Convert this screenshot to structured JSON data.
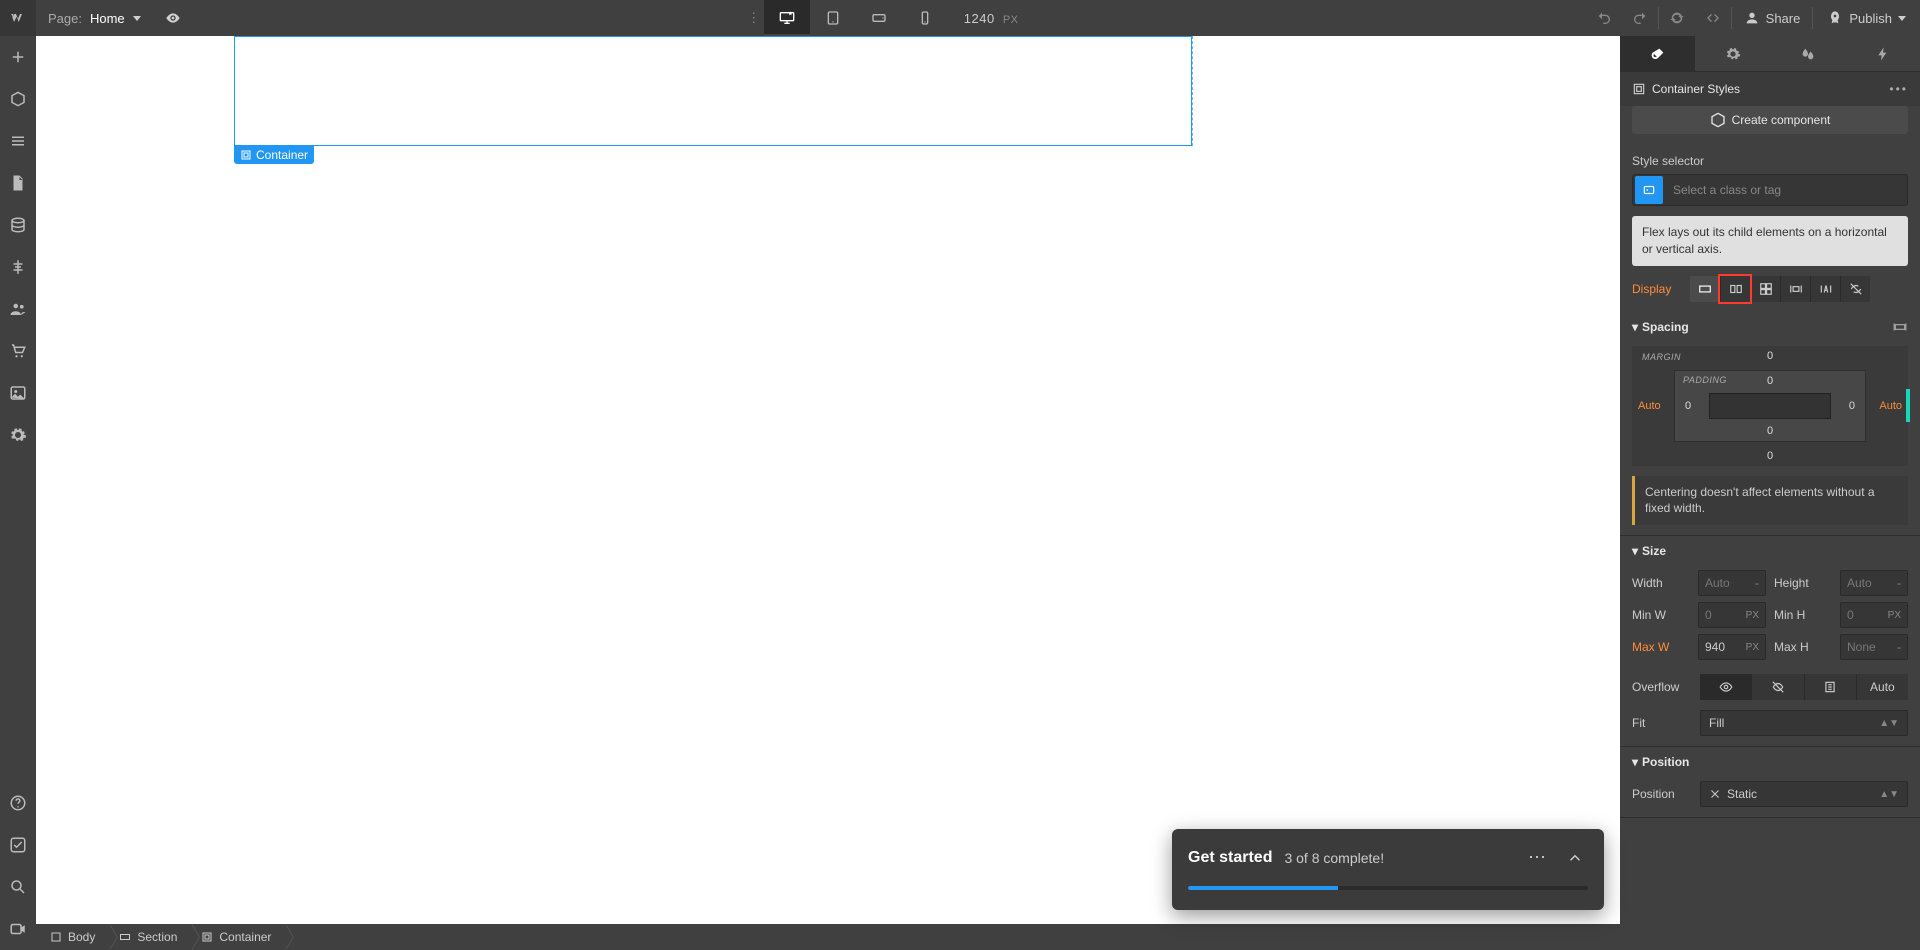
{
  "topbar": {
    "page_label": "Page:",
    "page_name": "Home",
    "canvas_width": "1240",
    "canvas_unit": "PX",
    "share": "Share",
    "publish": "Publish"
  },
  "canvas": {
    "selected_tag": "Container"
  },
  "breadcrumb": {
    "items": [
      "Body",
      "Section",
      "Container"
    ]
  },
  "right": {
    "container_styles_label": "Container Styles",
    "create_component": "Create component",
    "style_selector_label": "Style selector",
    "class_placeholder": "Select a class or tag",
    "display_tooltip": "Flex lays out its child elements on a horizontal or vertical axis.",
    "display_label": "Display",
    "spacing_label": "Spacing",
    "margin_caption": "MARGIN",
    "padding_caption": "PADDING",
    "margin": {
      "top": "0",
      "right": "Auto",
      "bottom": "0",
      "left": "Auto"
    },
    "padding": {
      "top": "0",
      "right": "0",
      "bottom": "0",
      "left": "0"
    },
    "centering_note": "Centering doesn't affect elements without a fixed width.",
    "size_label": "Size",
    "size": {
      "width_l": "Width",
      "width_v": "Auto",
      "height_l": "Height",
      "height_v": "Auto",
      "minw_l": "Min W",
      "minw_v": "0",
      "minw_u": "PX",
      "minh_l": "Min H",
      "minh_v": "0",
      "minh_u": "PX",
      "maxw_l": "Max W",
      "maxw_v": "940",
      "maxw_u": "PX",
      "maxh_l": "Max H",
      "maxh_v": "None"
    },
    "overflow_label": "Overflow",
    "overflow_auto": "Auto",
    "fit_label": "Fit",
    "fit_value": "Fill",
    "position_section": "Position",
    "position_label": "Position",
    "position_value": "Static"
  },
  "toast": {
    "title": "Get started",
    "subtitle": "3 of 8 complete!"
  }
}
